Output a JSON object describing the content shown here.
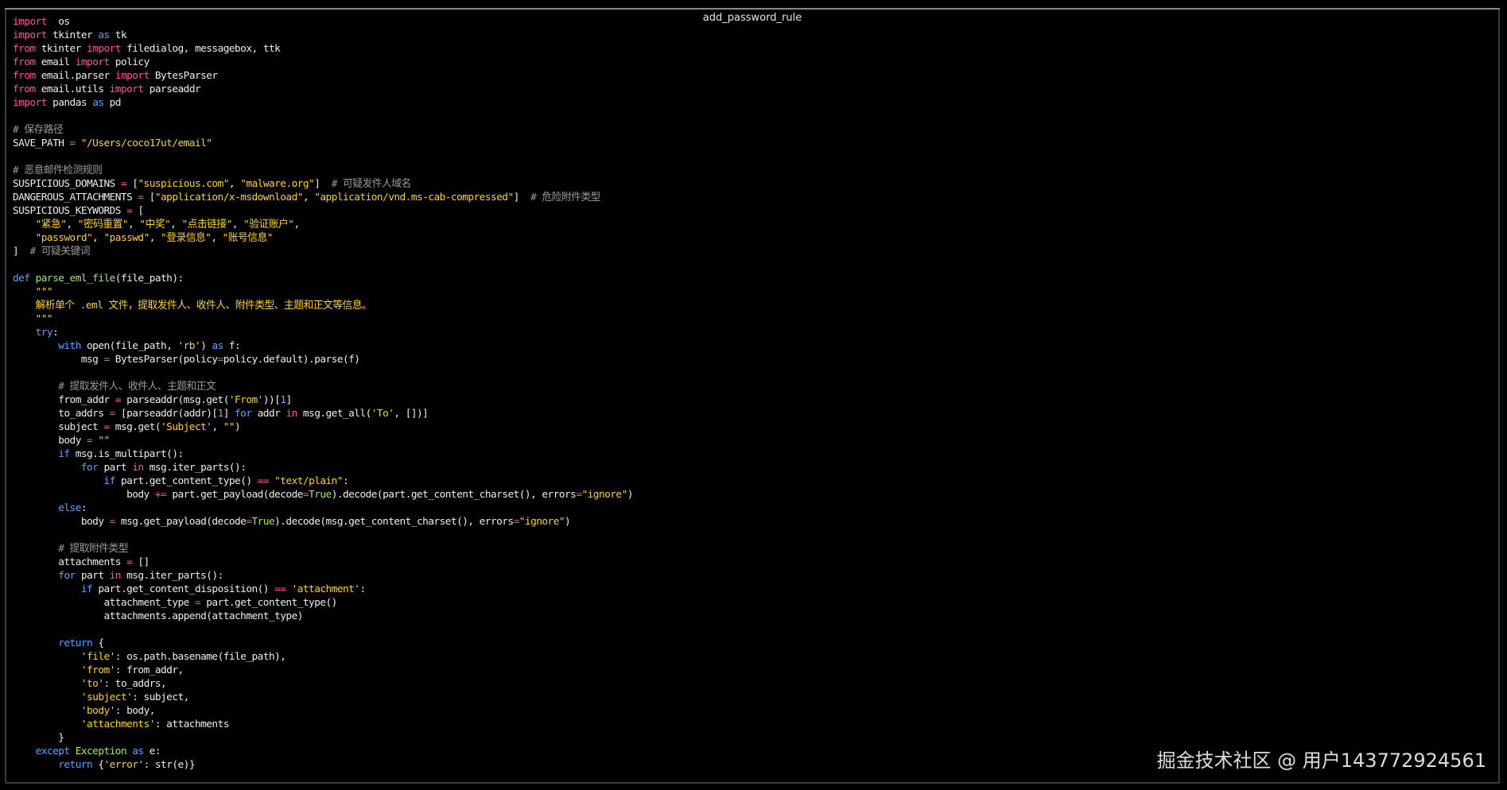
{
  "window": {
    "title": "add_password_rule"
  },
  "watermark": "掘金技术社区 @ 用户143772924561",
  "colors": {
    "background": "#000000",
    "text": "#ededed",
    "keyword": "#ff4fa5",
    "def_keyword": "#5aa2ff",
    "string": "#ffd21f",
    "comment": "#9b9b9b",
    "number": "#b08cff",
    "builtin": "#9cf24a"
  },
  "code_lines": [
    [
      [
        "kw",
        "import"
      ],
      [
        "",
        "  os"
      ]
    ],
    [
      [
        "kw",
        "import"
      ],
      [
        "",
        " tkinter "
      ],
      [
        "bl",
        "as"
      ],
      [
        "",
        " tk"
      ]
    ],
    [
      [
        "kw",
        "from"
      ],
      [
        "",
        " tkinter "
      ],
      [
        "kw",
        "import"
      ],
      [
        "",
        " filedialog, messagebox, ttk"
      ]
    ],
    [
      [
        "kw",
        "from"
      ],
      [
        "",
        " email "
      ],
      [
        "kw",
        "import"
      ],
      [
        "",
        " policy"
      ]
    ],
    [
      [
        "kw",
        "from"
      ],
      [
        "",
        " email.parser "
      ],
      [
        "kw",
        "import"
      ],
      [
        "",
        " BytesParser"
      ]
    ],
    [
      [
        "kw",
        "from"
      ],
      [
        "",
        " email.utils "
      ],
      [
        "kw",
        "import"
      ],
      [
        "",
        " parseaddr"
      ]
    ],
    [
      [
        "kw",
        "import"
      ],
      [
        "",
        " pandas "
      ],
      [
        "bl",
        "as"
      ],
      [
        "",
        " pd"
      ]
    ],
    [],
    [
      [
        "cm",
        "# 保存路径"
      ]
    ],
    [
      [
        "",
        "SAVE_PATH "
      ],
      [
        "op",
        "="
      ],
      [
        "str",
        " \"/Users/coco17ut/email\""
      ]
    ],
    [],
    [
      [
        "cm",
        "# 恶意邮件检测规则"
      ]
    ],
    [
      [
        "",
        "SUSPICIOUS_DOMAINS "
      ],
      [
        "op",
        "="
      ],
      [
        "",
        " ["
      ],
      [
        "str",
        "\"suspicious.com\""
      ],
      [
        "",
        ", "
      ],
      [
        "str",
        "\"malware.org\""
      ],
      [
        "",
        "]  "
      ],
      [
        "cm",
        "# 可疑发件人域名"
      ]
    ],
    [
      [
        "",
        "DANGEROUS_ATTACHMENTS "
      ],
      [
        "op",
        "="
      ],
      [
        "",
        " ["
      ],
      [
        "str",
        "\"application/x-msdownload\""
      ],
      [
        "",
        ", "
      ],
      [
        "str",
        "\"application/vnd.ms-cab-compressed\""
      ],
      [
        "",
        "]  "
      ],
      [
        "cm",
        "# 危险附件类型"
      ]
    ],
    [
      [
        "",
        "SUSPICIOUS_KEYWORDS "
      ],
      [
        "op",
        "="
      ],
      [
        "",
        " ["
      ]
    ],
    [
      [
        "",
        "    "
      ],
      [
        "str",
        "\"紧急\""
      ],
      [
        "",
        ", "
      ],
      [
        "str",
        "\"密码重置\""
      ],
      [
        "",
        ", "
      ],
      [
        "str",
        "\"中奖\""
      ],
      [
        "",
        ", "
      ],
      [
        "str",
        "\"点击链接\""
      ],
      [
        "",
        ", "
      ],
      [
        "str",
        "\"验证账户\""
      ],
      [
        "",
        ","
      ]
    ],
    [
      [
        "",
        "    "
      ],
      [
        "str",
        "\"password\""
      ],
      [
        "",
        ", "
      ],
      [
        "str",
        "\"passwd\""
      ],
      [
        "",
        ", "
      ],
      [
        "str",
        "\"登录信息\""
      ],
      [
        "",
        ", "
      ],
      [
        "str",
        "\"账号信息\""
      ]
    ],
    [
      [
        "",
        "]  "
      ],
      [
        "cm",
        "# 可疑关键词"
      ]
    ],
    [],
    [
      [
        "bl",
        "def"
      ],
      [
        "bi",
        " parse_eml_file"
      ],
      [
        "",
        "(file_path):"
      ]
    ],
    [
      [
        "str",
        "    \"\"\""
      ]
    ],
    [
      [
        "str",
        "    解析单个 .eml 文件，提取发件人、收件人、附件类型、主题和正文等信息。"
      ]
    ],
    [
      [
        "str",
        "    \"\"\""
      ]
    ],
    [
      [
        "",
        "    "
      ],
      [
        "bl",
        "try"
      ],
      [
        "",
        ":"
      ]
    ],
    [
      [
        "",
        "        "
      ],
      [
        "bl",
        "with"
      ],
      [
        "",
        " open(file_path, "
      ],
      [
        "str",
        "'rb'"
      ],
      [
        "",
        ") "
      ],
      [
        "bl",
        "as"
      ],
      [
        "",
        " f:"
      ]
    ],
    [
      [
        "",
        "            msg "
      ],
      [
        "op",
        "="
      ],
      [
        "",
        " BytesParser(policy"
      ],
      [
        "op",
        "="
      ],
      [
        "",
        "policy.default).parse(f)"
      ]
    ],
    [],
    [
      [
        "cm",
        "        # 提取发件人、收件人、主题和正文"
      ]
    ],
    [
      [
        "",
        "        from_addr "
      ],
      [
        "op",
        "="
      ],
      [
        "",
        " parseaddr(msg.get("
      ],
      [
        "str",
        "'From'"
      ],
      [
        "",
        "))["
      ],
      [
        "num",
        "1"
      ],
      [
        "",
        "]"
      ]
    ],
    [
      [
        "",
        "        to_addrs "
      ],
      [
        "op",
        "="
      ],
      [
        "",
        " [parseaddr(addr)["
      ],
      [
        "num",
        "1"
      ],
      [
        "",
        "] "
      ],
      [
        "bl",
        "for"
      ],
      [
        "",
        " addr "
      ],
      [
        "kw",
        "in"
      ],
      [
        "",
        " msg.get_all("
      ],
      [
        "str",
        "'To'"
      ],
      [
        "",
        ", [])]"
      ]
    ],
    [
      [
        "",
        "        subject "
      ],
      [
        "op",
        "="
      ],
      [
        "",
        " msg.get("
      ],
      [
        "str",
        "'Subject'"
      ],
      [
        "",
        ", "
      ],
      [
        "str",
        "\"\""
      ],
      [
        "",
        ")"
      ]
    ],
    [
      [
        "",
        "        body "
      ],
      [
        "op",
        "="
      ],
      [
        "str",
        " \"\""
      ]
    ],
    [
      [
        "",
        "        "
      ],
      [
        "bl",
        "if"
      ],
      [
        "",
        " msg.is_multipart():"
      ]
    ],
    [
      [
        "",
        "            "
      ],
      [
        "bl",
        "for"
      ],
      [
        "",
        " part "
      ],
      [
        "kw",
        "in"
      ],
      [
        "",
        " msg.iter_parts():"
      ]
    ],
    [
      [
        "",
        "                "
      ],
      [
        "bl",
        "if"
      ],
      [
        "",
        " part.get_content_type() "
      ],
      [
        "op",
        "=="
      ],
      [
        "str",
        " \"text/plain\""
      ],
      [
        "",
        ":"
      ]
    ],
    [
      [
        "",
        "                    body "
      ],
      [
        "op",
        "+="
      ],
      [
        "",
        " part.get_payload(decode"
      ],
      [
        "op",
        "="
      ],
      [
        "bi",
        "True"
      ],
      [
        "",
        ").decode(part.get_content_charset(), errors"
      ],
      [
        "op",
        "="
      ],
      [
        "str",
        "\"ignore\""
      ],
      [
        "",
        ")"
      ]
    ],
    [
      [
        "",
        "        "
      ],
      [
        "bl",
        "else"
      ],
      [
        "",
        ":"
      ]
    ],
    [
      [
        "",
        "            body "
      ],
      [
        "op",
        "="
      ],
      [
        "",
        " msg.get_payload(decode"
      ],
      [
        "op",
        "="
      ],
      [
        "bi",
        "True"
      ],
      [
        "",
        ").decode(msg.get_content_charset(), errors"
      ],
      [
        "op",
        "="
      ],
      [
        "str",
        "\"ignore\""
      ],
      [
        "",
        ")"
      ]
    ],
    [],
    [
      [
        "cm",
        "        # 提取附件类型"
      ]
    ],
    [
      [
        "",
        "        attachments "
      ],
      [
        "op",
        "="
      ],
      [
        "",
        " []"
      ]
    ],
    [
      [
        "",
        "        "
      ],
      [
        "bl",
        "for"
      ],
      [
        "",
        " part "
      ],
      [
        "kw",
        "in"
      ],
      [
        "",
        " msg.iter_parts():"
      ]
    ],
    [
      [
        "",
        "            "
      ],
      [
        "bl",
        "if"
      ],
      [
        "",
        " part.get_content_disposition() "
      ],
      [
        "op",
        "=="
      ],
      [
        "str",
        " 'attachment'"
      ],
      [
        "",
        ":"
      ]
    ],
    [
      [
        "",
        "                attachment_type "
      ],
      [
        "op",
        "="
      ],
      [
        "",
        " part.get_content_type()"
      ]
    ],
    [
      [
        "",
        "                attachments.append(attachment_type)"
      ]
    ],
    [],
    [
      [
        "",
        "        "
      ],
      [
        "bl",
        "return"
      ],
      [
        "",
        " {"
      ]
    ],
    [
      [
        "",
        "            "
      ],
      [
        "str",
        "'file'"
      ],
      [
        "",
        ": os.path.basename(file_path),"
      ]
    ],
    [
      [
        "",
        "            "
      ],
      [
        "str",
        "'from'"
      ],
      [
        "",
        ": from_addr,"
      ]
    ],
    [
      [
        "",
        "            "
      ],
      [
        "str",
        "'to'"
      ],
      [
        "",
        ": to_addrs,"
      ]
    ],
    [
      [
        "",
        "            "
      ],
      [
        "str",
        "'subject'"
      ],
      [
        "",
        ": subject,"
      ]
    ],
    [
      [
        "",
        "            "
      ],
      [
        "str",
        "'body'"
      ],
      [
        "",
        ": body,"
      ]
    ],
    [
      [
        "",
        "            "
      ],
      [
        "str",
        "'attachments'"
      ],
      [
        "",
        ": attachments"
      ]
    ],
    [
      [
        "",
        "        }"
      ]
    ],
    [
      [
        "",
        "    "
      ],
      [
        "bl",
        "except"
      ],
      [
        "bi",
        " Exception"
      ],
      [
        "",
        " "
      ],
      [
        "bl",
        "as"
      ],
      [
        "",
        " e:"
      ]
    ],
    [
      [
        "",
        "        "
      ],
      [
        "bl",
        "return"
      ],
      [
        "",
        " {"
      ],
      [
        "str",
        "'error'"
      ],
      [
        "",
        ": str(e)}"
      ]
    ]
  ]
}
